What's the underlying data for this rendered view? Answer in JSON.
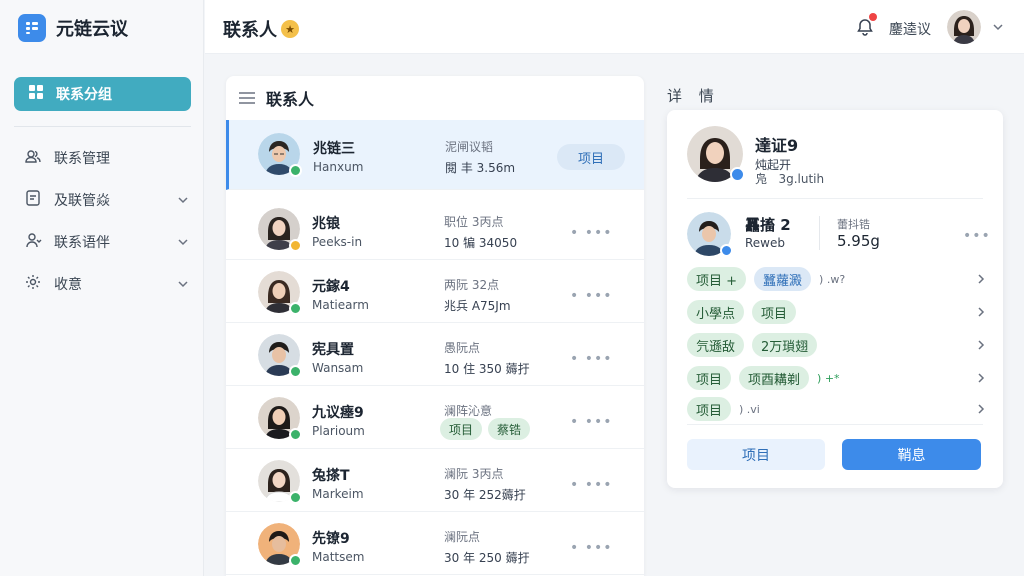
{
  "app": {
    "title": "元链云议"
  },
  "sidebar": {
    "active_label": "联系分组",
    "items": [
      {
        "label": "联系管理",
        "icon": "people-icon"
      },
      {
        "label": "及联管焱",
        "icon": "document-icon"
      },
      {
        "label": "联系语伴",
        "icon": "person-icon"
      },
      {
        "label": "收意",
        "icon": "settings-icon"
      }
    ]
  },
  "header": {
    "title": "联系人",
    "username": "鏖逵议"
  },
  "contacts": {
    "title": "联系人",
    "rows": [
      {
        "name": "兆链三",
        "sub": "Hanxum",
        "meta1": "泥闸议韬",
        "meta2": "閱 丰 3.56m",
        "tag": "项目",
        "status": "online"
      },
      {
        "name": "兆锒",
        "sub": "Peeks-in",
        "meta1": "职位 3丙点",
        "meta2": "10 犏 34050",
        "status": "away"
      },
      {
        "name": "元鎵4",
        "sub": "Matiearm",
        "meta1": "两阮 32点",
        "meta2": "兆兵 A75Jm",
        "status": "online"
      },
      {
        "name": "宪具置",
        "sub": "Wansam",
        "meta1": "愚阮点",
        "meta2": "10 住 350 薅扜",
        "status": "online"
      },
      {
        "name": "九议瘗9",
        "sub": "Plarioum",
        "meta1": "澜阵沁意",
        "chips": [
          "项目",
          "蔡锆"
        ],
        "status": "online"
      },
      {
        "name": "兔搽T",
        "sub": "Markeim",
        "meta1": "澜阮 3丙点",
        "meta2": "30 年 252薅扜",
        "status": "online"
      },
      {
        "name": "先镣9",
        "sub": "Mattsem",
        "meta1": "澜阮点",
        "meta2": "30 年 250 薅扜",
        "status": "online"
      }
    ]
  },
  "detail": {
    "label": "详 情",
    "name": "達证9",
    "sub1": "炖起开",
    "sub2": "3g.lutih",
    "sub2_prefix": "凫",
    "contact2": {
      "name": "靐搐 2",
      "sub": "Reweb",
      "meta1": "蕾抖锆",
      "meta2": "5.95g"
    },
    "rows": [
      {
        "chips": [
          {
            "label": "项目 +",
            "color": "green"
          },
          {
            "label": "蠶蘿澱",
            "color": "blue"
          }
        ],
        "extra": ") .w?"
      },
      {
        "chips": [
          {
            "label": "小學点",
            "color": "green"
          },
          {
            "label": "项目",
            "color": "green"
          }
        ],
        "extra": ""
      },
      {
        "chips": [
          {
            "label": "氕遜敌",
            "color": "green"
          },
          {
            "label": "2万瑣翅",
            "color": "green"
          }
        ],
        "extra": ""
      },
      {
        "chips": [
          {
            "label": "项目",
            "color": "green"
          },
          {
            "label": "项酉耩剃",
            "color": "green"
          }
        ],
        "extra": ") +*"
      },
      {
        "chips": [
          {
            "label": "项目",
            "color": "green"
          }
        ],
        "extra": ") .vi"
      }
    ],
    "secondary_button": "项目",
    "primary_button": "鞘息"
  },
  "colors": {
    "accent": "#3d8bea",
    "sidebar_active": "#41abc0",
    "status_online": "#3bb26a",
    "status_away": "#f2b632",
    "notification": "#ef4444"
  }
}
